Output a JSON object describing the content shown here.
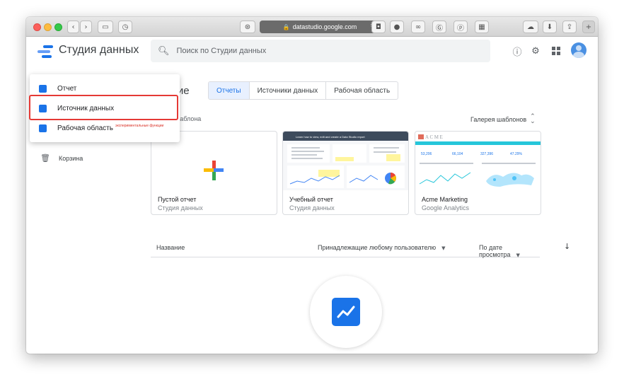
{
  "browser": {
    "url": "datastudio.google.com"
  },
  "app": {
    "title": "Студия данных"
  },
  "search": {
    "placeholder": "Поиск по Студии данных"
  },
  "main": {
    "heading_partial": "чие",
    "tabs": [
      {
        "label": "Отчеты",
        "active": true
      },
      {
        "label": "Источники данных",
        "active": false
      },
      {
        "label": "Рабочая область",
        "active": false
      }
    ],
    "templates_label": "шаблона",
    "gallery_label": "Галерея шаблонов",
    "cards": [
      {
        "title": "Пустой отчет",
        "subtitle": "Студия данных"
      },
      {
        "title": "Учебный отчет",
        "subtitle": "Студия данных"
      },
      {
        "title": "Acme Marketing",
        "subtitle": "Google Analytics"
      }
    ],
    "list_header": {
      "name": "Название",
      "owner": "Принадлежащие любому пользователю",
      "sort": "По дате просмотра"
    }
  },
  "dropdown": {
    "items": [
      {
        "label": "Отчет"
      },
      {
        "label": "Источник данных"
      },
      {
        "label": "Рабочая область",
        "badge": "экспериментальные функции"
      }
    ]
  },
  "nav": {
    "trash_label": "Корзина"
  },
  "thumbs": {
    "tutorial_header": "Learn how to view, edit and create a Data Studio report",
    "acme_logo": "ACME",
    "acme_metrics": [
      "53,206",
      "66,104",
      "327,396",
      "47.29%"
    ]
  },
  "colors": {
    "accent": "#1a73e8",
    "highlight": "#e53935"
  }
}
